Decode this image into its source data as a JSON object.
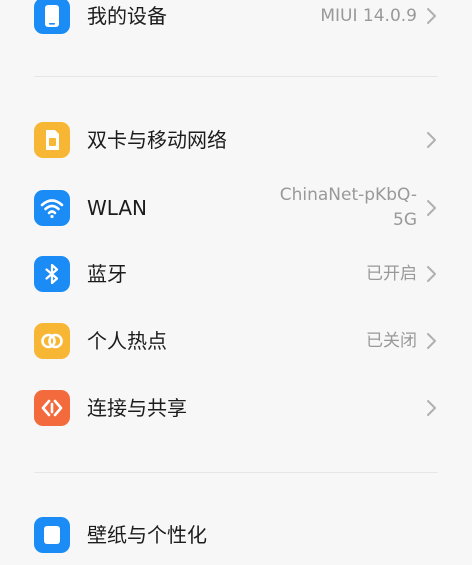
{
  "top": {
    "device": {
      "label": "我的设备",
      "value": "MIUI 14.0.9",
      "icon": "phone-icon",
      "color": "#1b8cf5"
    }
  },
  "connectivity": {
    "items": [
      {
        "label": "双卡与移动网络",
        "value": "",
        "icon": "sim-card-icon",
        "color": "#f7b735"
      },
      {
        "label": "WLAN",
        "value_line1": "ChinaNet-pKbQ-",
        "value_line2": "5G",
        "icon": "wifi-icon",
        "color": "#1b8cf5"
      },
      {
        "label": "蓝牙",
        "value": "已开启",
        "icon": "bluetooth-icon",
        "color": "#1b8cf5"
      },
      {
        "label": "个人热点",
        "value": "已关闭",
        "icon": "hotspot-icon",
        "color": "#f7b735"
      },
      {
        "label": "连接与共享",
        "value": "",
        "icon": "share-icon",
        "color": "#f36a3c"
      }
    ]
  },
  "bottom": {
    "partial": {
      "label": "壁纸与个性化",
      "icon": "wallpaper-icon",
      "color": "#1b8cf5"
    }
  }
}
